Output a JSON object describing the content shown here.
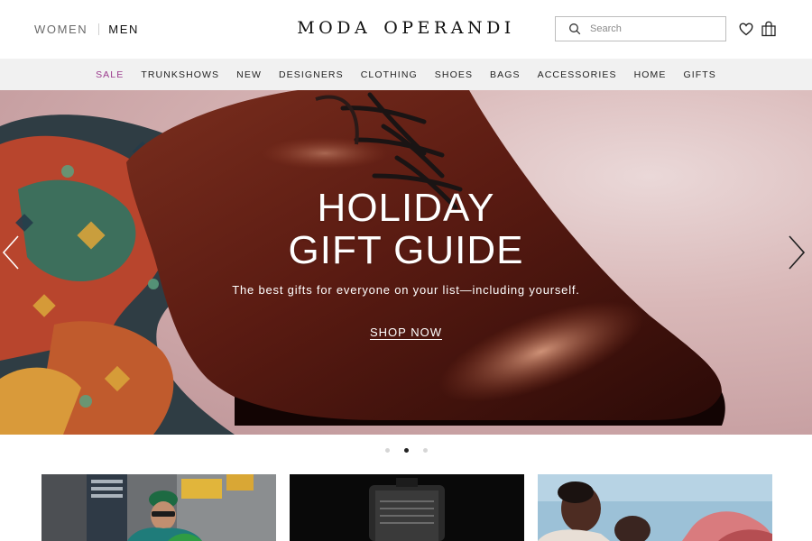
{
  "header": {
    "gender": {
      "women": "WOMEN",
      "men": "MEN"
    },
    "logo": {
      "word1": "MODA",
      "word2": "OPERANDI"
    },
    "search": {
      "placeholder": "Search",
      "icon": "search-icon"
    },
    "icons": [
      "heart-icon",
      "shopping-bag-icon"
    ]
  },
  "nav": {
    "items": [
      "SALE",
      "TRUNKSHOWS",
      "NEW",
      "DESIGNERS",
      "CLOTHING",
      "SHOES",
      "BAGS",
      "ACCESSORIES",
      "HOME",
      "GIFTS"
    ],
    "sale_color": "#9b3b8d"
  },
  "hero": {
    "title_line1": "HOLIDAY",
    "title_line2": "GIFT GUIDE",
    "subtitle": "The best gifts for everyone on your list—including yourself.",
    "cta": "SHOP NOW"
  },
  "carousel": {
    "slides": 3,
    "active_slide": 2
  },
  "tiles": [
    "street-style-photo",
    "watch-photo",
    "models-photo"
  ]
}
